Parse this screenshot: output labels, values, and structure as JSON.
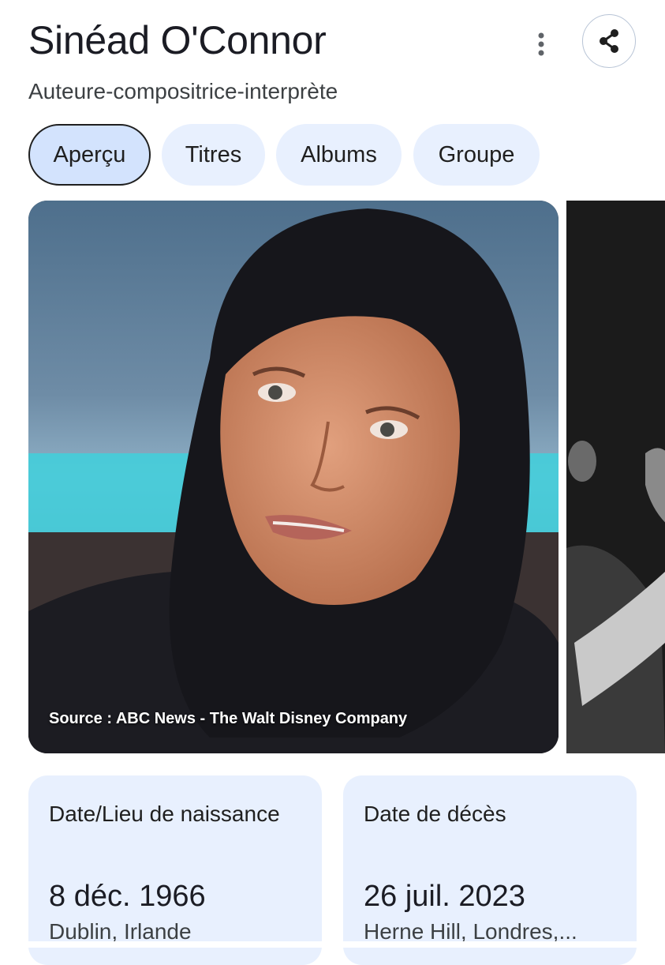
{
  "header": {
    "title": "Sinéad O'Connor",
    "subtitle": "Auteure-compositrice-interprète",
    "more_icon": "more-vert-icon",
    "share_icon": "share-icon"
  },
  "tabs": [
    {
      "label": "Aperçu",
      "active": true
    },
    {
      "label": "Titres",
      "active": false
    },
    {
      "label": "Albums",
      "active": false
    },
    {
      "label": "Groupe",
      "active": false
    }
  ],
  "photos": {
    "main_caption": "Source : ABC News - The Walt Disney Company"
  },
  "facts": [
    {
      "label": "Date/Lieu de naissance",
      "value": "8 déc. 1966",
      "sub": "Dublin, Irlande"
    },
    {
      "label": "Date de décès",
      "value": "26 juil. 2023",
      "sub": "Herne Hill, Londres,..."
    }
  ],
  "colors": {
    "chip_bg": "#e8f0fe",
    "chip_active_bg": "#d3e3fd",
    "card_bg": "#e8f0fe"
  }
}
